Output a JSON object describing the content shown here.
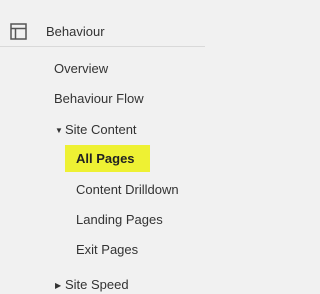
{
  "sidebar": {
    "section": {
      "label": "Behaviour",
      "icon": "behaviour-icon"
    },
    "items": {
      "overview": "Overview",
      "behaviour_flow": "Behaviour Flow",
      "site_content": {
        "label": "Site Content",
        "expanded": true,
        "children": {
          "all_pages": "All Pages",
          "content_drilldown": "Content Drilldown",
          "landing_pages": "Landing Pages",
          "exit_pages": "Exit Pages"
        }
      },
      "site_speed": {
        "label": "Site Speed",
        "expanded": false
      }
    },
    "active_item": "All Pages",
    "colors": {
      "background": "#f1f1f1",
      "highlight": "#eef133",
      "text": "#333333"
    }
  }
}
